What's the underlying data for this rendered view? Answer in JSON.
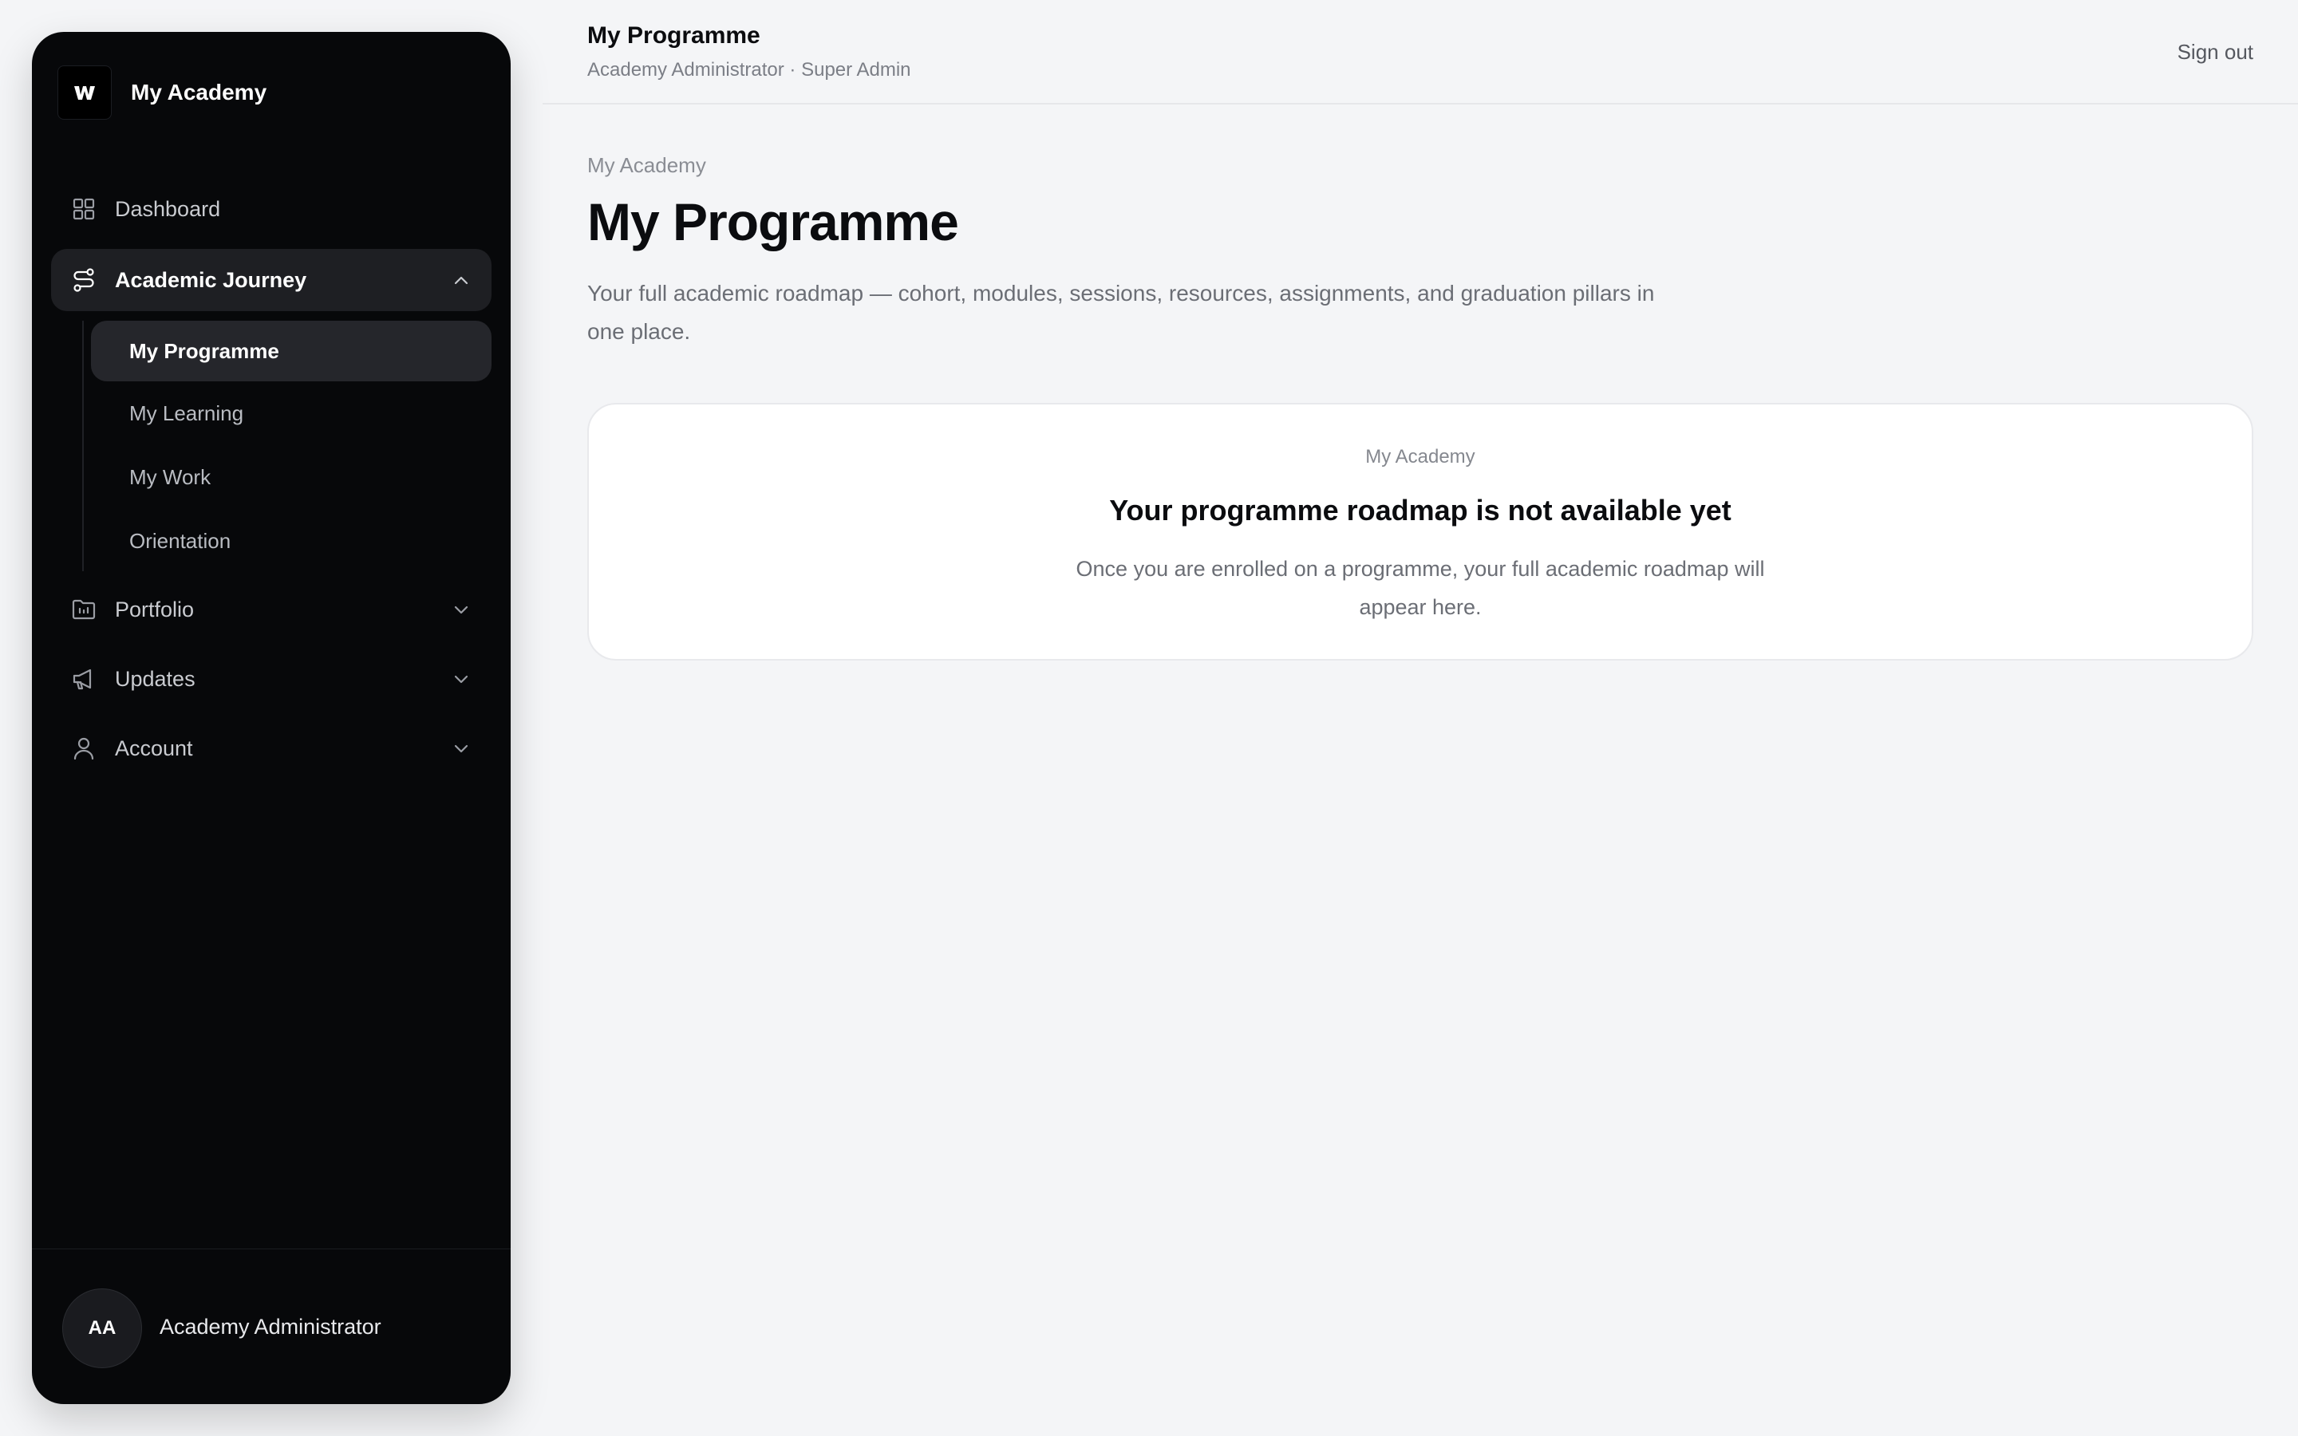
{
  "sidebar": {
    "brand_name": "My Academy",
    "nav": [
      {
        "label": "Dashboard",
        "icon": "grid-icon"
      },
      {
        "label": "Academic Journey",
        "icon": "route-icon",
        "expanded": true
      },
      {
        "label": "Portfolio",
        "icon": "folder-icon"
      },
      {
        "label": "Updates",
        "icon": "megaphone-icon"
      },
      {
        "label": "Account",
        "icon": "user-icon"
      }
    ],
    "sub_items": [
      {
        "label": "My Programme",
        "active": true
      },
      {
        "label": "My Learning"
      },
      {
        "label": "My Work"
      },
      {
        "label": "Orientation"
      }
    ],
    "user": {
      "initials": "AA",
      "name": "Academy Administrator"
    }
  },
  "header": {
    "title": "My Programme",
    "subtitle": "Academy Administrator · Super Admin",
    "signout_label": "Sign out"
  },
  "main": {
    "breadcrumb": "My Academy",
    "title": "My Programme",
    "description": "Your full academic roadmap — cohort, modules, sessions, resources, assignments, and graduation pillars in one place.",
    "empty_state": {
      "kicker": "My Academy",
      "title": "Your programme roadmap is not available yet",
      "body": "Once you are enrolled on a programme, your full academic roadmap will appear here."
    }
  },
  "colors": {
    "sidebar_bg": "#07080a",
    "page_bg": "#f4f5f7",
    "active_item_bg": "#1e1f23"
  }
}
